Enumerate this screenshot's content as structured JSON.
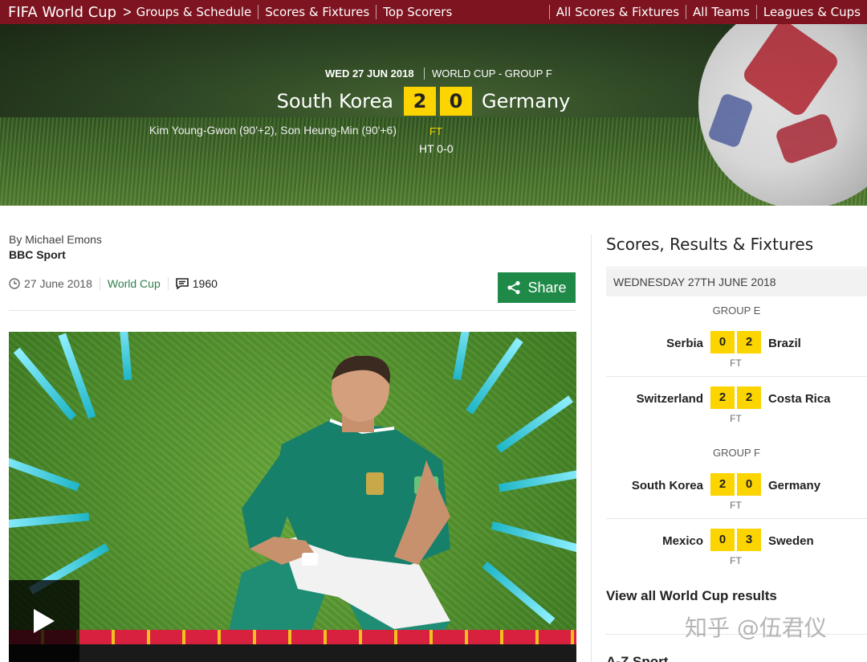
{
  "nav": {
    "brand": "FIFA World Cup",
    "chevron": ">",
    "left_links": [
      "Groups & Schedule",
      "Scores & Fixtures",
      "Top Scorers"
    ],
    "right_links": [
      "All Scores & Fixtures",
      "All Teams",
      "Leagues & Cups"
    ]
  },
  "match": {
    "date": "WED 27 JUN 2018",
    "competition": "WORLD CUP - GROUP F",
    "home_team": "South Korea",
    "away_team": "Germany",
    "home_score": "2",
    "away_score": "0",
    "scorers": "Kim Young-Gwon (90'+2), Son Heung-Min (90'+6)",
    "status": "FT",
    "half_time": "HT 0-0"
  },
  "article": {
    "author": "By Michael Emons",
    "organisation": "BBC Sport",
    "date": "27 June 2018",
    "topic": "World Cup",
    "comment_count": "1960",
    "share_label": "Share"
  },
  "sidebar": {
    "title": "Scores, Results & Fixtures",
    "day": "WEDNESDAY 27TH JUNE 2018",
    "groups": [
      {
        "name": "GROUP E",
        "matches": [
          {
            "home": "Serbia",
            "home_score": "0",
            "away_score": "2",
            "away": "Brazil",
            "status": "FT"
          },
          {
            "home": "Switzerland",
            "home_score": "2",
            "away_score": "2",
            "away": "Costa Rica",
            "status": "FT"
          }
        ]
      },
      {
        "name": "GROUP F",
        "matches": [
          {
            "home": "South Korea",
            "home_score": "2",
            "away_score": "0",
            "away": "Germany",
            "status": "FT"
          },
          {
            "home": "Mexico",
            "home_score": "0",
            "away_score": "3",
            "away": "Sweden",
            "status": "FT"
          }
        ]
      }
    ],
    "view_all": "View all World Cup results",
    "next_section": "A-Z Sport"
  },
  "watermark": "知乎 @伍君仪",
  "colors": {
    "nav_bg": "#7d1420",
    "score_yellow": "#fcd400",
    "share_green": "#1f8a47",
    "topic_green": "#2f7d4c"
  },
  "icons": [
    "clock-icon",
    "comment-icon",
    "share-icon",
    "play-icon"
  ]
}
